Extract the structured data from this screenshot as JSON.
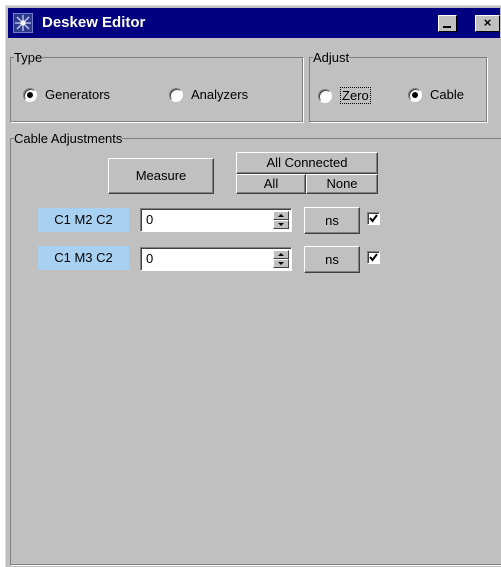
{
  "window": {
    "title": "Deskew Editor",
    "app_icon": "starburst-icon",
    "minimize_icon": "minimize-icon",
    "close_icon": "close-icon",
    "close_glyph": "×"
  },
  "type_group": {
    "legend": "Type",
    "options": [
      {
        "label": "Generators",
        "selected": true
      },
      {
        "label": "Analyzers",
        "selected": false
      }
    ]
  },
  "adjust_group": {
    "legend": "Adjust",
    "options": [
      {
        "label": "Zero",
        "selected": false
      },
      {
        "label": "Cable",
        "selected": true
      }
    ]
  },
  "cable_group": {
    "legend": "Cable Adjustments",
    "measure_label": "Measure",
    "all_connected_label": "All Connected",
    "all_label": "All",
    "none_label": "None",
    "rows": [
      {
        "name": "C1 M2 C2",
        "value": "0",
        "unit": "ns",
        "checked": true
      },
      {
        "name": "C1 M3 C2",
        "value": "0",
        "unit": "ns",
        "checked": true
      }
    ]
  },
  "colors": {
    "title_bar": "#000080",
    "window_bg": "#c0c0c0",
    "tag_bg": "#a8d0f0"
  }
}
